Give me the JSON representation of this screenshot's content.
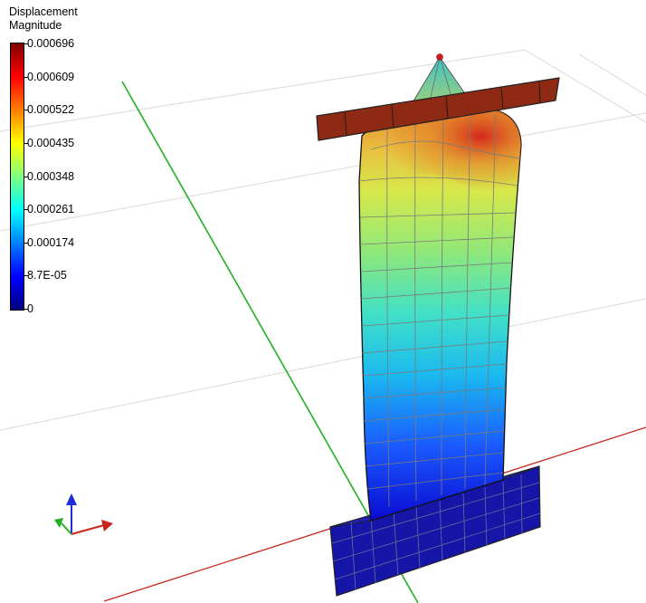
{
  "legend": {
    "title": "Displacement\nMagnitude",
    "ticks": [
      "0.000696",
      "0.000609",
      "0.000522",
      "0.000435",
      "0.000348",
      "0.000261",
      "0.000174",
      "8.7E-05",
      "0"
    ]
  },
  "colors": {
    "x_axis": "#c8261c",
    "y_axis": "#22b022",
    "z_axis": "#1c2cd8",
    "top_plate": "#8e2a14",
    "base": "#1a1ab0",
    "mesh_lines": "#808080"
  }
}
